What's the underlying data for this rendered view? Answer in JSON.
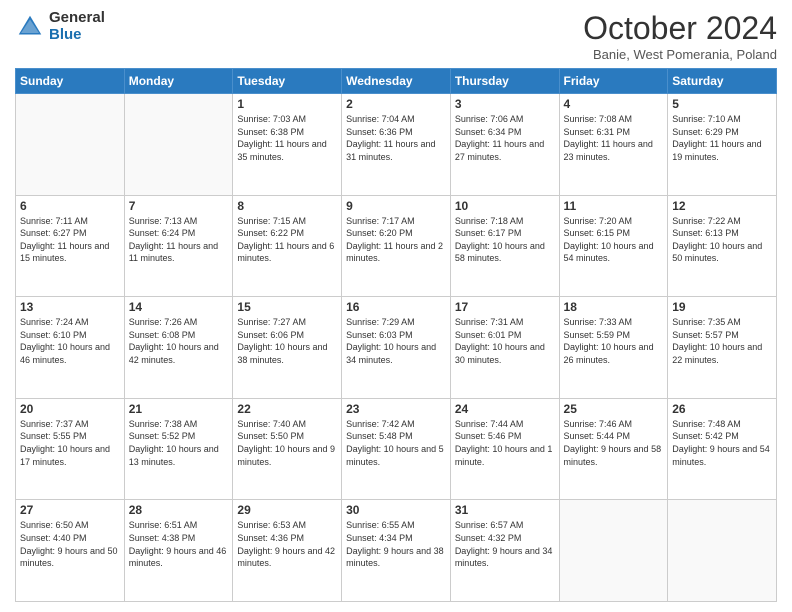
{
  "logo": {
    "general": "General",
    "blue": "Blue"
  },
  "title": "October 2024",
  "subtitle": "Banie, West Pomerania, Poland",
  "weekdays": [
    "Sunday",
    "Monday",
    "Tuesday",
    "Wednesday",
    "Thursday",
    "Friday",
    "Saturday"
  ],
  "weeks": [
    [
      {
        "day": null
      },
      {
        "day": null
      },
      {
        "day": "1",
        "sunrise": "Sunrise: 7:03 AM",
        "sunset": "Sunset: 6:38 PM",
        "daylight": "Daylight: 11 hours and 35 minutes."
      },
      {
        "day": "2",
        "sunrise": "Sunrise: 7:04 AM",
        "sunset": "Sunset: 6:36 PM",
        "daylight": "Daylight: 11 hours and 31 minutes."
      },
      {
        "day": "3",
        "sunrise": "Sunrise: 7:06 AM",
        "sunset": "Sunset: 6:34 PM",
        "daylight": "Daylight: 11 hours and 27 minutes."
      },
      {
        "day": "4",
        "sunrise": "Sunrise: 7:08 AM",
        "sunset": "Sunset: 6:31 PM",
        "daylight": "Daylight: 11 hours and 23 minutes."
      },
      {
        "day": "5",
        "sunrise": "Sunrise: 7:10 AM",
        "sunset": "Sunset: 6:29 PM",
        "daylight": "Daylight: 11 hours and 19 minutes."
      }
    ],
    [
      {
        "day": "6",
        "sunrise": "Sunrise: 7:11 AM",
        "sunset": "Sunset: 6:27 PM",
        "daylight": "Daylight: 11 hours and 15 minutes."
      },
      {
        "day": "7",
        "sunrise": "Sunrise: 7:13 AM",
        "sunset": "Sunset: 6:24 PM",
        "daylight": "Daylight: 11 hours and 11 minutes."
      },
      {
        "day": "8",
        "sunrise": "Sunrise: 7:15 AM",
        "sunset": "Sunset: 6:22 PM",
        "daylight": "Daylight: 11 hours and 6 minutes."
      },
      {
        "day": "9",
        "sunrise": "Sunrise: 7:17 AM",
        "sunset": "Sunset: 6:20 PM",
        "daylight": "Daylight: 11 hours and 2 minutes."
      },
      {
        "day": "10",
        "sunrise": "Sunrise: 7:18 AM",
        "sunset": "Sunset: 6:17 PM",
        "daylight": "Daylight: 10 hours and 58 minutes."
      },
      {
        "day": "11",
        "sunrise": "Sunrise: 7:20 AM",
        "sunset": "Sunset: 6:15 PM",
        "daylight": "Daylight: 10 hours and 54 minutes."
      },
      {
        "day": "12",
        "sunrise": "Sunrise: 7:22 AM",
        "sunset": "Sunset: 6:13 PM",
        "daylight": "Daylight: 10 hours and 50 minutes."
      }
    ],
    [
      {
        "day": "13",
        "sunrise": "Sunrise: 7:24 AM",
        "sunset": "Sunset: 6:10 PM",
        "daylight": "Daylight: 10 hours and 46 minutes."
      },
      {
        "day": "14",
        "sunrise": "Sunrise: 7:26 AM",
        "sunset": "Sunset: 6:08 PM",
        "daylight": "Daylight: 10 hours and 42 minutes."
      },
      {
        "day": "15",
        "sunrise": "Sunrise: 7:27 AM",
        "sunset": "Sunset: 6:06 PM",
        "daylight": "Daylight: 10 hours and 38 minutes."
      },
      {
        "day": "16",
        "sunrise": "Sunrise: 7:29 AM",
        "sunset": "Sunset: 6:03 PM",
        "daylight": "Daylight: 10 hours and 34 minutes."
      },
      {
        "day": "17",
        "sunrise": "Sunrise: 7:31 AM",
        "sunset": "Sunset: 6:01 PM",
        "daylight": "Daylight: 10 hours and 30 minutes."
      },
      {
        "day": "18",
        "sunrise": "Sunrise: 7:33 AM",
        "sunset": "Sunset: 5:59 PM",
        "daylight": "Daylight: 10 hours and 26 minutes."
      },
      {
        "day": "19",
        "sunrise": "Sunrise: 7:35 AM",
        "sunset": "Sunset: 5:57 PM",
        "daylight": "Daylight: 10 hours and 22 minutes."
      }
    ],
    [
      {
        "day": "20",
        "sunrise": "Sunrise: 7:37 AM",
        "sunset": "Sunset: 5:55 PM",
        "daylight": "Daylight: 10 hours and 17 minutes."
      },
      {
        "day": "21",
        "sunrise": "Sunrise: 7:38 AM",
        "sunset": "Sunset: 5:52 PM",
        "daylight": "Daylight: 10 hours and 13 minutes."
      },
      {
        "day": "22",
        "sunrise": "Sunrise: 7:40 AM",
        "sunset": "Sunset: 5:50 PM",
        "daylight": "Daylight: 10 hours and 9 minutes."
      },
      {
        "day": "23",
        "sunrise": "Sunrise: 7:42 AM",
        "sunset": "Sunset: 5:48 PM",
        "daylight": "Daylight: 10 hours and 5 minutes."
      },
      {
        "day": "24",
        "sunrise": "Sunrise: 7:44 AM",
        "sunset": "Sunset: 5:46 PM",
        "daylight": "Daylight: 10 hours and 1 minute."
      },
      {
        "day": "25",
        "sunrise": "Sunrise: 7:46 AM",
        "sunset": "Sunset: 5:44 PM",
        "daylight": "Daylight: 9 hours and 58 minutes."
      },
      {
        "day": "26",
        "sunrise": "Sunrise: 7:48 AM",
        "sunset": "Sunset: 5:42 PM",
        "daylight": "Daylight: 9 hours and 54 minutes."
      }
    ],
    [
      {
        "day": "27",
        "sunrise": "Sunrise: 6:50 AM",
        "sunset": "Sunset: 4:40 PM",
        "daylight": "Daylight: 9 hours and 50 minutes."
      },
      {
        "day": "28",
        "sunrise": "Sunrise: 6:51 AM",
        "sunset": "Sunset: 4:38 PM",
        "daylight": "Daylight: 9 hours and 46 minutes."
      },
      {
        "day": "29",
        "sunrise": "Sunrise: 6:53 AM",
        "sunset": "Sunset: 4:36 PM",
        "daylight": "Daylight: 9 hours and 42 minutes."
      },
      {
        "day": "30",
        "sunrise": "Sunrise: 6:55 AM",
        "sunset": "Sunset: 4:34 PM",
        "daylight": "Daylight: 9 hours and 38 minutes."
      },
      {
        "day": "31",
        "sunrise": "Sunrise: 6:57 AM",
        "sunset": "Sunset: 4:32 PM",
        "daylight": "Daylight: 9 hours and 34 minutes."
      },
      {
        "day": null
      },
      {
        "day": null
      }
    ]
  ]
}
